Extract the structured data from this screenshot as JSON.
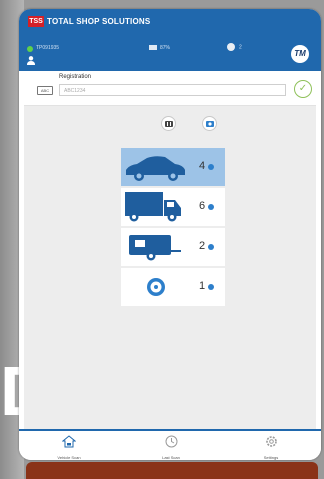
{
  "background": {
    "big_text": "D"
  },
  "header": {
    "logo": "TSS",
    "title": "TOTAL SHOP SOLUTIONS",
    "tm_logo": "TM"
  },
  "status": {
    "device": "TP091935",
    "battery": "87%",
    "notifications": "2"
  },
  "registration": {
    "label": "Registration",
    "placeholder": "ABC1234",
    "plate_icon": "ABC"
  },
  "vehicle_types": [
    {
      "name": "car",
      "count": "4",
      "selected": true
    },
    {
      "name": "truck",
      "count": "6",
      "selected": false
    },
    {
      "name": "caravan",
      "count": "2",
      "selected": false
    },
    {
      "name": "wheel",
      "count": "1",
      "selected": false
    }
  ],
  "nav": [
    {
      "label": "Vehicle Scan",
      "icon": "house-car-icon"
    },
    {
      "label": "Last Scan",
      "icon": "clock-icon"
    },
    {
      "label": "Settings",
      "icon": "gear-icon"
    }
  ],
  "colors": {
    "primary": "#2068ad",
    "selected": "#9dc3e7",
    "accent_green": "#8fc15a",
    "logo_red": "#d42027"
  }
}
